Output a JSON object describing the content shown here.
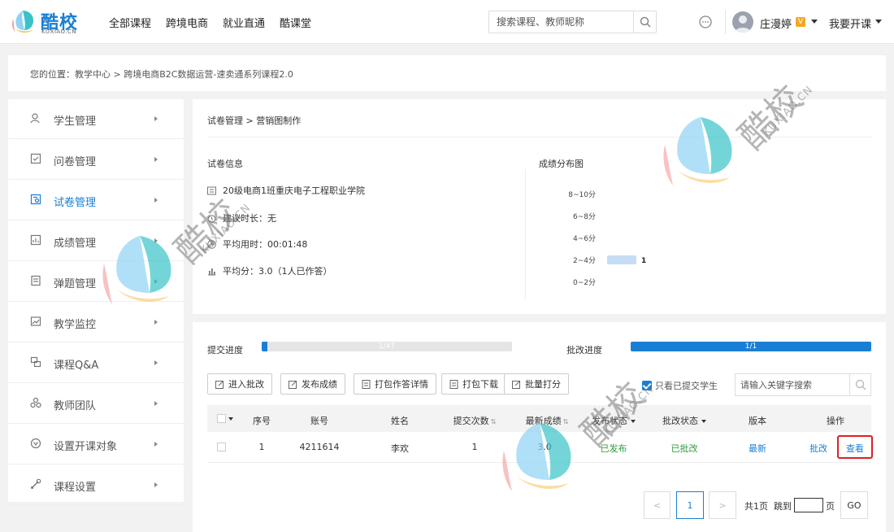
{
  "header": {
    "logo_text": "酷校",
    "logo_sub": "KUXIAO.CN",
    "nav": [
      "全部课程",
      "跨境电商",
      "就业直通",
      "酷课堂"
    ],
    "search_placeholder": "搜索课程、教师昵称",
    "username": "庄漫婷",
    "vip_badge": "V",
    "open_course": "我要开课"
  },
  "breadcrumb": "您的位置：教学中心 > 跨境电商B2C数据运营-速卖通系列课程2.0",
  "sidebar": {
    "items": [
      {
        "label": "学生管理",
        "icon": "student-icon"
      },
      {
        "label": "问卷管理",
        "icon": "survey-icon"
      },
      {
        "label": "试卷管理",
        "icon": "exam-icon",
        "active": true
      },
      {
        "label": "成绩管理",
        "icon": "grades-icon"
      },
      {
        "label": "弹题管理",
        "icon": "quiz-icon"
      },
      {
        "label": "教学监控",
        "icon": "monitor-icon"
      },
      {
        "label": "课程Q&A",
        "icon": "qa-icon"
      },
      {
        "label": "教师团队",
        "icon": "team-icon"
      },
      {
        "label": "设置开课对象",
        "icon": "target-icon"
      },
      {
        "label": "课程设置",
        "icon": "settings-icon"
      }
    ]
  },
  "exam": {
    "path": "试卷管理 > 营销图制作",
    "info_title": "试卷信息",
    "class_name": "20级电商1班重庆电子工程职业学院",
    "suggested_time": "建议时长：无",
    "avg_time": "平均用时：00:01:48",
    "avg_score": "平均分：3.0（1人已作答）",
    "dist_title": "成绩分布图"
  },
  "chart_data": {
    "type": "bar",
    "orientation": "horizontal",
    "title": "成绩分布图",
    "categories": [
      "8~10分",
      "6~8分",
      "4~6分",
      "2~4分",
      "0~2分"
    ],
    "values": [
      0,
      0,
      0,
      1,
      0
    ],
    "data_labels": [
      "",
      "",
      "",
      "1",
      ""
    ],
    "color": "#c5dcf5"
  },
  "progress": {
    "submit_label": "提交进度",
    "submit_text": "1/47",
    "submit_fraction": 0.0213,
    "grade_label": "批改进度",
    "grade_text": "1/1",
    "grade_fraction": 1.0
  },
  "toolbar": {
    "buttons": [
      "进入批改",
      "发布成绩",
      "打包作答详情",
      "打包下载",
      "批量打分"
    ],
    "only_submitted": "只看已提交学生",
    "search_placeholder": "请输入关键字搜索"
  },
  "table": {
    "headers": [
      "序号",
      "账号",
      "姓名",
      "提交次数",
      "最新成绩",
      "发布状态",
      "批改状态",
      "版本",
      "操作"
    ],
    "rows": [
      {
        "index": "1",
        "account": "4211614",
        "name": "李欢",
        "submits": "1",
        "score": "3.0",
        "publish": "已发布",
        "grade": "已批改",
        "version": "最新",
        "action_grade": "批改",
        "action_view": "查看"
      }
    ]
  },
  "pagination": {
    "prev": "<",
    "current": "1",
    "next": ">",
    "total": "共1页",
    "jump_to": "跳到",
    "page_unit": "页",
    "go": "GO"
  },
  "watermark": {
    "text": "酷校",
    "sub": "KUXIAO.CN"
  },
  "colors": {
    "primary": "#1a7fd4",
    "success": "#2e9c3f",
    "highlight": "#e02020"
  }
}
